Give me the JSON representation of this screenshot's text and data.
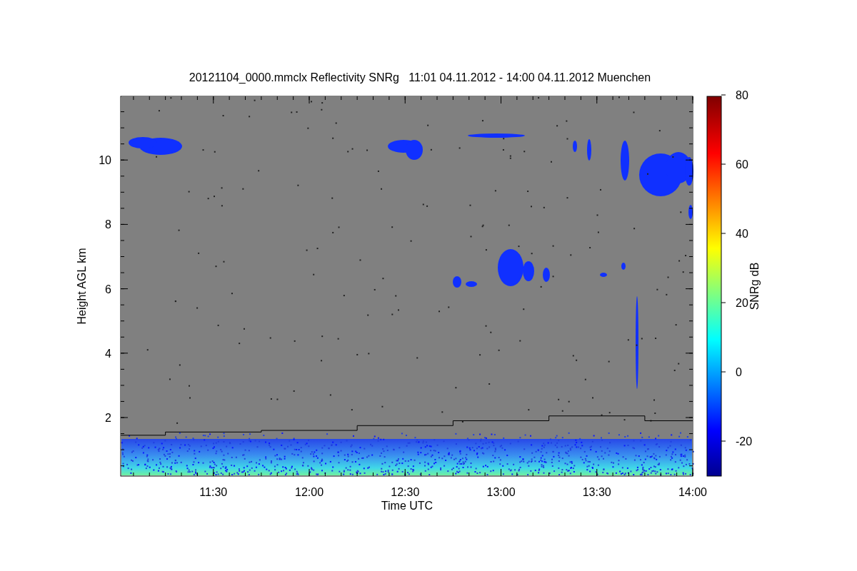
{
  "figure": {
    "title": "20121104_0000.mmclx Reflectivity SNRg   11:01 04.11.2012 - 14:00 04.11.2012 Muenchen",
    "plot": {
      "xlabel": "Time UTC",
      "ylabel": "Height AGL km",
      "xticks": [
        "11:30",
        "12:00",
        "12:30",
        "13:00",
        "13:30",
        "14:00"
      ],
      "yticks": [
        "10",
        "8",
        "6",
        "4",
        "2"
      ]
    },
    "colorbar": {
      "label": "SNRg dB",
      "ticks": [
        "80",
        "60",
        "40",
        "20",
        "0",
        "-20"
      ]
    }
  }
}
